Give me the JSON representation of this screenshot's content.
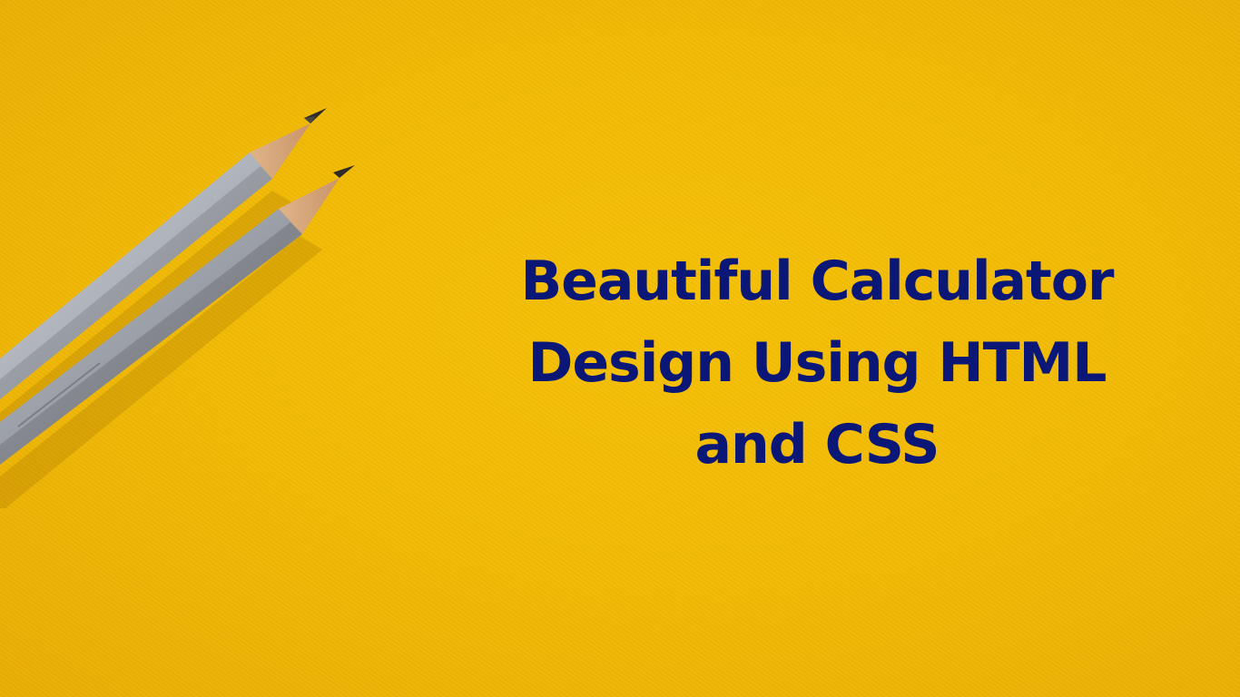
{
  "slide": {
    "background_color": "#f2bb05",
    "title_color": "#0b1777",
    "title_lines": [
      "Beautiful Calculator",
      "Design Using HTML",
      "and CSS"
    ]
  },
  "image": {
    "icon": "pencils-icon"
  }
}
